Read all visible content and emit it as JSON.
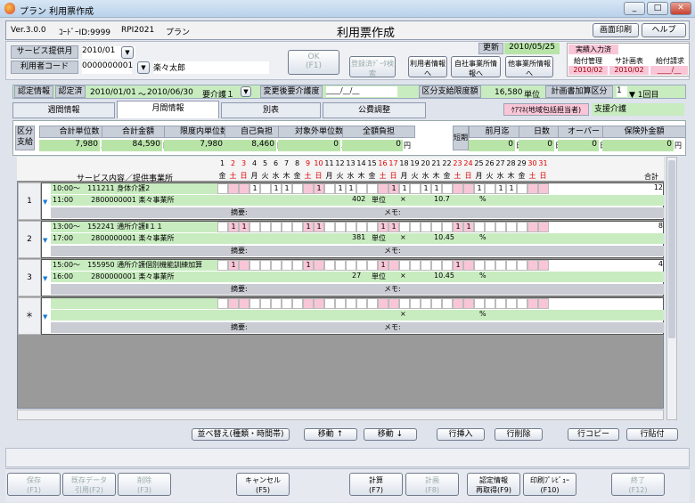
{
  "window": {
    "title": "プラン 利用票作成",
    "min": "_",
    "max": "□",
    "close": "✕"
  },
  "info": {
    "version": "Ver.3.0.0",
    "keyid": "ｺｰﾄﾞｰID:9999",
    "code": "RPI2021",
    "app": "プラン",
    "screen_title": "利用票作成",
    "print_btn": "画面印刷",
    "help_btn": "ヘルプ"
  },
  "form": {
    "svc_month_label": "サービス提供月",
    "svc_month_value": "2010/01",
    "user_code_label": "利用者コード",
    "user_code_value": "0000000001",
    "user_name": "楽々太郎",
    "ok_label": "OK",
    "ok_key": "(F1)",
    "reg_btn": "登録済ﾃﾞｰﾀ検索",
    "user_info_btn": "利用者情報へ",
    "own_btn": "自社事業所情報へ",
    "other_btn": "他事業所情報へ",
    "update_label": "更新",
    "update_value": "2010/05/25"
  },
  "flags": {
    "title": "実績入力済",
    "h1": "給付管理",
    "h2": "サ計画表",
    "h3": "給付請求",
    "v1": "2010/02",
    "v2": "2010/02",
    "v3": "____/__"
  },
  "cert": {
    "label": "認定情報",
    "status": "認定済",
    "from": "2010/01/01",
    "tilde": "〜",
    "to": "2010/06/30",
    "level": "要介護１",
    "change_label": "変更後要介護度",
    "change_value": "____/__/__",
    "limit_label": "区分支給限度額",
    "limit_value": "16,580",
    "unit": "単位",
    "plan_label": "計画書加算区分",
    "plan_value": "1",
    "plan_suffix": "▼ 1回目"
  },
  "tabs": [
    "週間情報",
    "月間情報",
    "別表",
    "公費調整"
  ],
  "caremgr": {
    "label": "ｹｱﾏﾈ(地域包括担当者)",
    "value": "支援介護"
  },
  "summary": {
    "kubun": "区分",
    "shikyu": "支給",
    "h1": "合計単位数",
    "v1": "7,980",
    "u1": "単位",
    "h2": "合計金額",
    "v2": "84,590",
    "u2": "円",
    "h3": "限度内単位数",
    "v3": "7,980",
    "u3": "単位",
    "h4": "自己負担",
    "v4": "8,460",
    "u4": "円",
    "h5": "対象外単位数",
    "v5": "0",
    "u5": "単位",
    "h6": "全額負担",
    "v6": "0",
    "u6": "円",
    "tanki": "短期",
    "h7": "前月迄",
    "v7": "0",
    "u7": "日",
    "h8": "日数",
    "v8": "0",
    "u8": "日",
    "h9": "オーバー",
    "v9": "0",
    "u9": "日",
    "h10": "保険外金額",
    "v10": "0",
    "u10": "円"
  },
  "grid": {
    "col_label": "サービス内容／提供事業所",
    "total_label": "合計",
    "days": [
      "1",
      "2",
      "3",
      "4",
      "5",
      "6",
      "7",
      "8",
      "9",
      "10",
      "11",
      "12",
      "13",
      "14",
      "15",
      "16",
      "17",
      "18",
      "19",
      "20",
      "21",
      "22",
      "23",
      "24",
      "25",
      "26",
      "27",
      "28",
      "29",
      "30",
      "31"
    ],
    "weekdays": [
      "金",
      "土",
      "日",
      "月",
      "火",
      "水",
      "木",
      "金",
      "土",
      "日",
      "月",
      "火",
      "水",
      "木",
      "金",
      "土",
      "日",
      "月",
      "火",
      "水",
      "木",
      "金",
      "土",
      "日",
      "月",
      "火",
      "水",
      "木",
      "金",
      "土",
      "日"
    ],
    "memo_label": "メモ:",
    "tekiyo_label": "摘要:",
    "x_sign": "×",
    "pct": "%",
    "rows": [
      {
        "num": "1",
        "t1": "10:00〜",
        "t2": "11:00",
        "svc": "111211 身体介護2",
        "office": "2800000001 楽々事業所",
        "units": "402",
        "unit_lbl": "単位",
        "rate": "10.7",
        "total": "12",
        "marks": {
          "4": "1",
          "6": "1",
          "7": "1",
          "10": "1",
          "12": "1",
          "13": "1",
          "17": "1",
          "18": "1",
          "20": "1",
          "21": "1",
          "25": "1",
          "27": "1",
          "28": "1"
        }
      },
      {
        "num": "2",
        "t1": "13:00〜",
        "t2": "17:00",
        "svc": "152241 通所介護Ⅱ１１",
        "office": "2800000001 楽々事業所",
        "units": "381",
        "unit_lbl": "単位",
        "rate": "10.45",
        "total": "8",
        "marks": {
          "2": "1",
          "3": "1",
          "9": "1",
          "10": "1",
          "16": "1",
          "17": "1",
          "23": "1",
          "24": "1"
        }
      },
      {
        "num": "3",
        "t1": "15:00〜",
        "t2": "16:00",
        "svc": "155950 通所介護個別機能訓練加算",
        "office": "2800000001 楽々事業所",
        "units": "27",
        "unit_lbl": "単位",
        "rate": "10.45",
        "total": "4",
        "marks": {
          "2": "1",
          "9": "1",
          "16": "1",
          "23": "1"
        }
      },
      {
        "num": "＊",
        "t1": "",
        "t2": "",
        "svc": "",
        "office": "",
        "units": "",
        "unit_lbl": "",
        "rate": "",
        "total": "",
        "marks": {}
      }
    ]
  },
  "actions": {
    "sort": "並べ替え(種類・時間帯)",
    "up": "移動 ↑",
    "down": "移動 ↓",
    "insert": "行挿入",
    "delete": "行削除",
    "copy": "行コピー",
    "paste": "行貼付"
  },
  "fkeys": [
    {
      "l1": "保存",
      "l2": "(F1)",
      "dis": true
    },
    {
      "l1": "既存データ",
      "l2": "引用(F2)",
      "dis": true
    },
    {
      "l1": "削除",
      "l2": "(F3)",
      "dis": true
    },
    {
      "l1": "キャンセル",
      "l2": "(F5)",
      "dis": false
    },
    {
      "l1": "計算",
      "l2": "(F7)",
      "dis": false
    },
    {
      "l1": "計画",
      "l2": "(F8)",
      "dis": true
    },
    {
      "l1": "認定情報",
      "l2": "再取得(F9)",
      "dis": false
    },
    {
      "l1": "印刷ﾌﾟﾚﾋﾞｭｰ",
      "l2": "(F10)",
      "dis": false
    },
    {
      "l1": "終了",
      "l2": "(F12)",
      "dis": true
    }
  ]
}
